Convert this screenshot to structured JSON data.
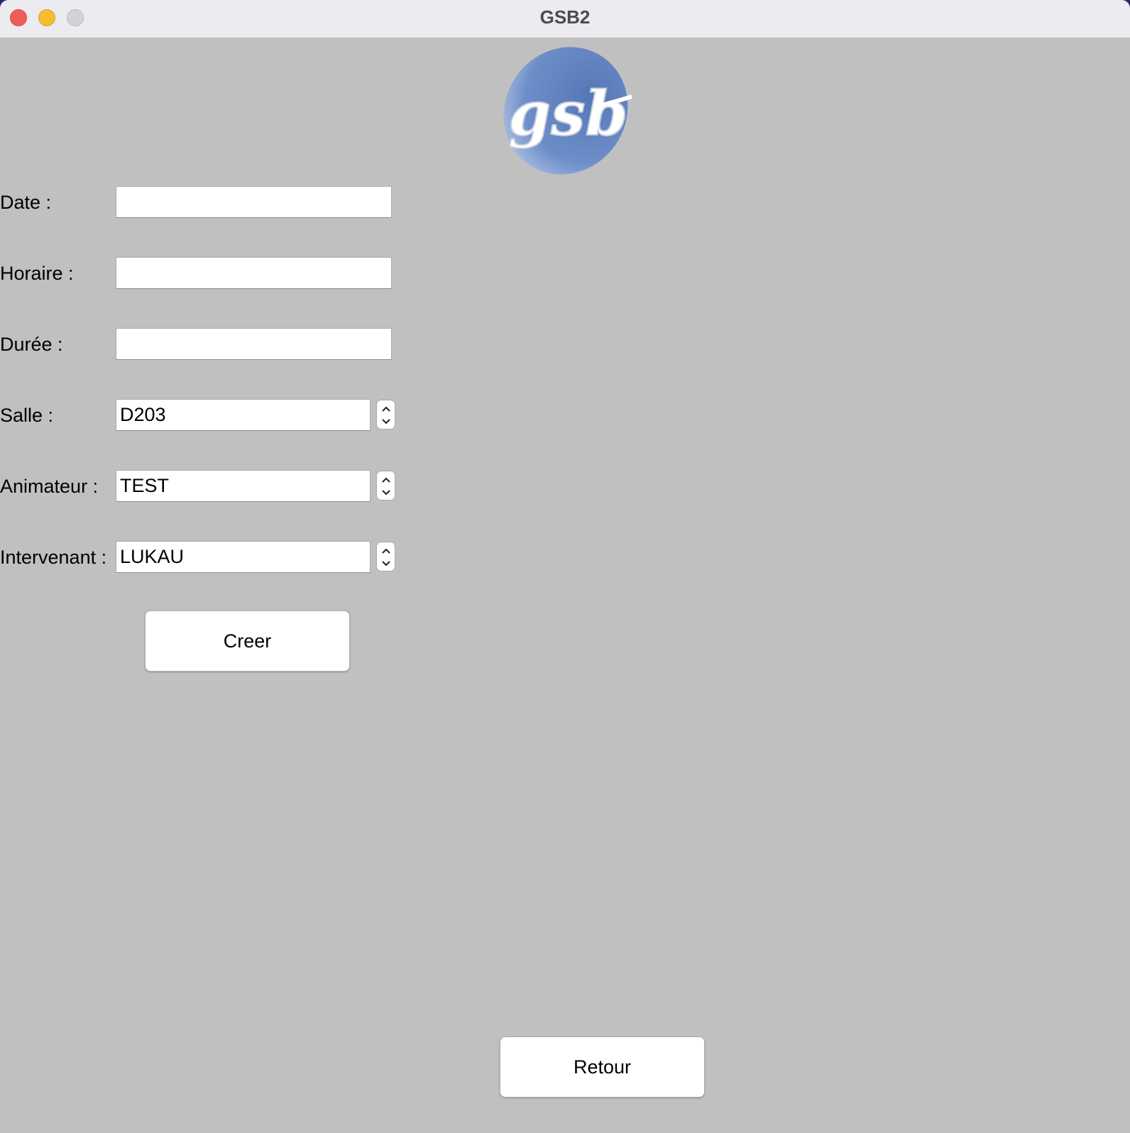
{
  "window": {
    "title": "GSB2"
  },
  "logo": {
    "text": "gsb",
    "color": "#5d80bd"
  },
  "form": {
    "date": {
      "label": "Date :",
      "value": ""
    },
    "horaire": {
      "label": "Horaire :",
      "value": ""
    },
    "duree": {
      "label": "Durée :",
      "value": ""
    },
    "salle": {
      "label": "Salle :",
      "value": "D203"
    },
    "animateur": {
      "label": "Animateur :",
      "value": "TEST"
    },
    "intervenant": {
      "label": "Intervenant :",
      "value": "LUKAU"
    }
  },
  "buttons": {
    "creer": "Creer",
    "retour": "Retour"
  }
}
